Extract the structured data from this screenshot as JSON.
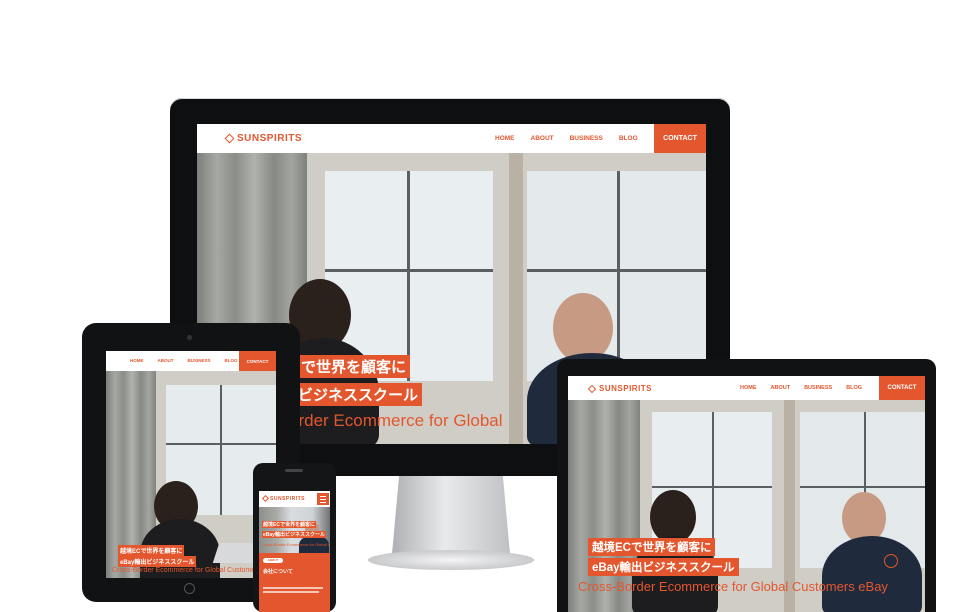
{
  "site": {
    "logo": "SUNSPIRITS",
    "nav": [
      "HOME",
      "ABOUT",
      "BUSINESS",
      "BLOG"
    ],
    "contact": "CONTACT",
    "hero_line1": "越境ECで世界を顧客に",
    "hero_line2": "eBay輸出ビジネススクール",
    "hero_en": "Cross-Border Ecommerce for Global Customers eBay",
    "monitor_line1": "で世界を顧客に",
    "monitor_line2": "出ビジネススクール",
    "monitor_en": "order Ecommerce for Global",
    "tablet_nav_left": "HOME",
    "tablet_en": "Cross-Border Ecommerce for Global Customers",
    "phone_button": "ABOUT",
    "phone_about": "会社について"
  },
  "colors": {
    "accent": "#e4572e",
    "device_frame": "#111214",
    "stand": "#c8c9cb"
  }
}
